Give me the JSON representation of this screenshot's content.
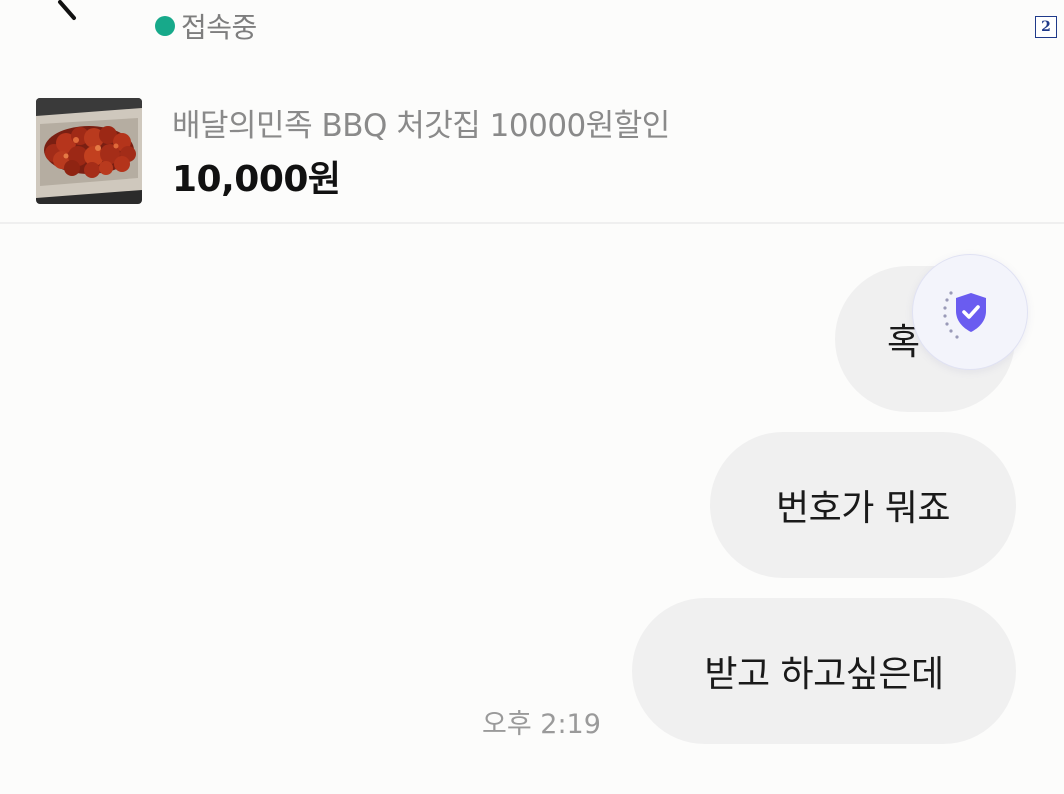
{
  "header": {
    "status_text": "접속중",
    "status_color": "#17a98a",
    "page_badge": "2"
  },
  "product": {
    "title": "배달의민족 BBQ 처갓집 10000원할인",
    "price": "10,000원"
  },
  "messages": [
    {
      "text": "혹",
      "side": "right"
    },
    {
      "text": "번호가 뭐죠",
      "side": "right"
    },
    {
      "text": "받고 하고싶은데",
      "side": "right"
    }
  ],
  "timestamp": "오후 2:19",
  "icons": {
    "back": "back-arrow-icon",
    "shield": "shield-check-icon"
  },
  "colors": {
    "bubble_bg": "#f0f0f0",
    "shield_accent": "#6a5cf0"
  }
}
